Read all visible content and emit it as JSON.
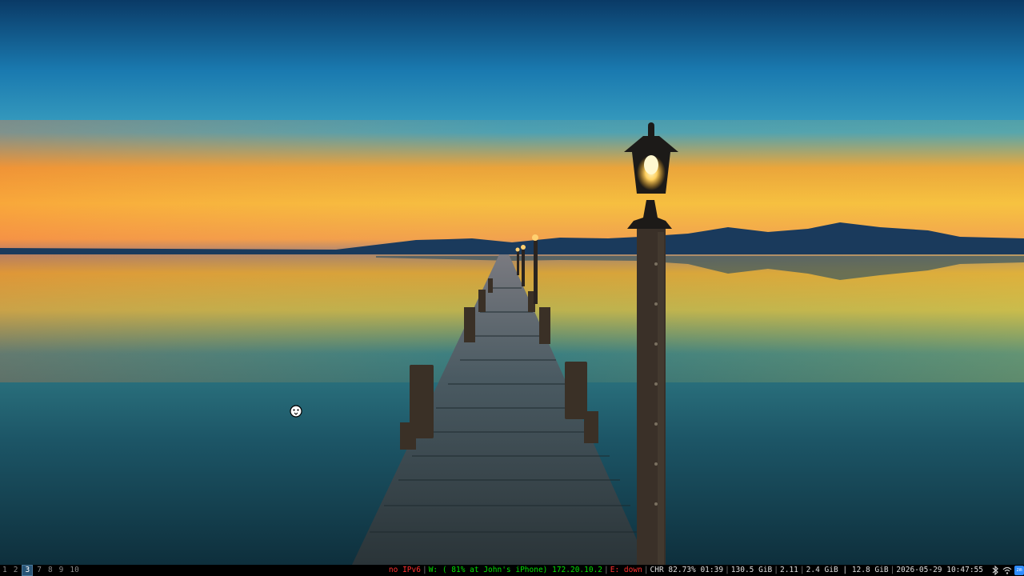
{
  "workspaces": [
    {
      "label": "1",
      "active": false
    },
    {
      "label": "2",
      "active": false
    },
    {
      "label": "3",
      "active": true
    },
    {
      "label": "7",
      "active": false
    },
    {
      "label": "8",
      "active": false
    },
    {
      "label": "9",
      "active": false
    },
    {
      "label": "10",
      "active": false
    }
  ],
  "status": {
    "ipv6": "no IPv6",
    "wifi": "W: ( 81% at John's iPhone) 172.20.10.2",
    "ethernet": "E: down",
    "battery": "CHR 82.73% 01:39",
    "disk": "130.5 GiB",
    "load": "2.11",
    "memory": "2.4 GiB | 12.8 GiB",
    "datetime": "2026-05-29 10:47:55"
  },
  "tray": {
    "bluetooth": "bluetooth-icon",
    "wifi": "wifi-icon",
    "app": "zm"
  },
  "colors": {
    "status_bad": "#ff3030",
    "status_good": "#00e000",
    "workspace_active_bg": "#285577"
  }
}
